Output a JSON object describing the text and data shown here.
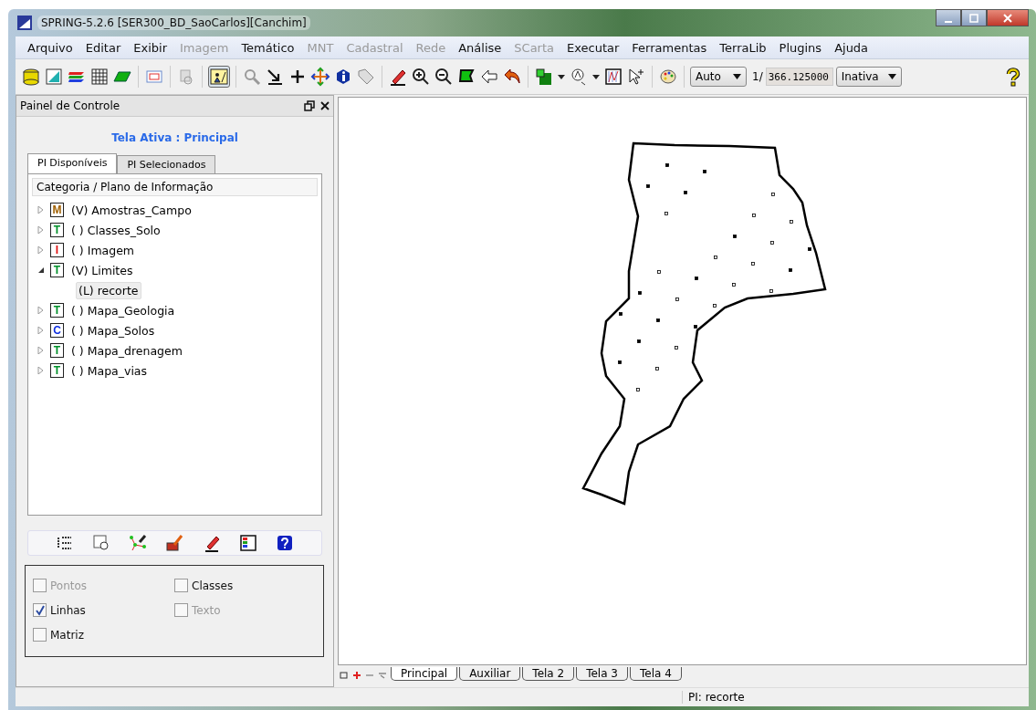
{
  "window": {
    "title": "SPRING-5.2.6 [SER300_BD_SaoCarlos][Canchim]"
  },
  "menu": [
    {
      "label": "Arquivo",
      "disabled": false
    },
    {
      "label": "Editar",
      "disabled": false
    },
    {
      "label": "Exibir",
      "disabled": false
    },
    {
      "label": "Imagem",
      "disabled": true
    },
    {
      "label": "Temático",
      "disabled": false
    },
    {
      "label": "MNT",
      "disabled": true
    },
    {
      "label": "Cadastral",
      "disabled": true
    },
    {
      "label": "Rede",
      "disabled": true
    },
    {
      "label": "Análise",
      "disabled": false
    },
    {
      "label": "SCarta",
      "disabled": true
    },
    {
      "label": "Executar",
      "disabled": false
    },
    {
      "label": "Ferramentas",
      "disabled": false
    },
    {
      "label": "TerraLib",
      "disabled": false
    },
    {
      "label": "Plugins",
      "disabled": false
    },
    {
      "label": "Ajuda",
      "disabled": false
    }
  ],
  "toolbar": {
    "mode": "Auto",
    "scale_prefix": "1/",
    "scale": "366.125000",
    "cursor_mode": "Inativa"
  },
  "panel": {
    "title": "Painel de Controle",
    "active_view": "Tela Ativa : Principal",
    "tabs": [
      {
        "label": "PI Disponíveis",
        "selected": true
      },
      {
        "label": "PI Selecionados",
        "selected": false
      }
    ],
    "tree_header": "Categoria / Plano de Informação",
    "tree": [
      {
        "badge": "M",
        "kind": "mnt",
        "label": "(V) Amostras_Campo",
        "expanded": false
      },
      {
        "badge": "T",
        "kind": "tematico",
        "label": "( ) Classes_Solo",
        "expanded": false
      },
      {
        "badge": "I",
        "kind": "imagem",
        "label": "( ) Imagem",
        "expanded": false
      },
      {
        "badge": "T",
        "kind": "tematico",
        "label": "(V) Limites",
        "expanded": true,
        "children": [
          {
            "label": "(L) recorte",
            "selected": true
          }
        ]
      },
      {
        "badge": "T",
        "kind": "tematico",
        "label": "( ) Mapa_Geologia",
        "expanded": false
      },
      {
        "badge": "C",
        "kind": "cadastral",
        "label": "( ) Mapa_Solos",
        "expanded": false
      },
      {
        "badge": "T",
        "kind": "tematico",
        "label": "( ) Mapa_drenagem",
        "expanded": false
      },
      {
        "badge": "T",
        "kind": "tematico",
        "label": "( ) Mapa_vias",
        "expanded": false
      }
    ],
    "checkboxes": [
      {
        "label": "Pontos",
        "checked": false,
        "disabled": true
      },
      {
        "label": "Classes",
        "checked": false,
        "disabled": false
      },
      {
        "label": "Linhas",
        "checked": true,
        "disabled": false
      },
      {
        "label": "Texto",
        "checked": false,
        "disabled": true
      },
      {
        "label": "Matriz",
        "checked": false,
        "disabled": false
      }
    ]
  },
  "view_tabs": [
    {
      "label": "Principal",
      "selected": true
    },
    {
      "label": "Auxiliar",
      "selected": false
    },
    {
      "label": "Tela 2",
      "selected": false
    },
    {
      "label": "Tela 3",
      "selected": false
    },
    {
      "label": "Tela 4",
      "selected": false
    }
  ],
  "status_bar": {
    "text": "PI: recorte"
  }
}
